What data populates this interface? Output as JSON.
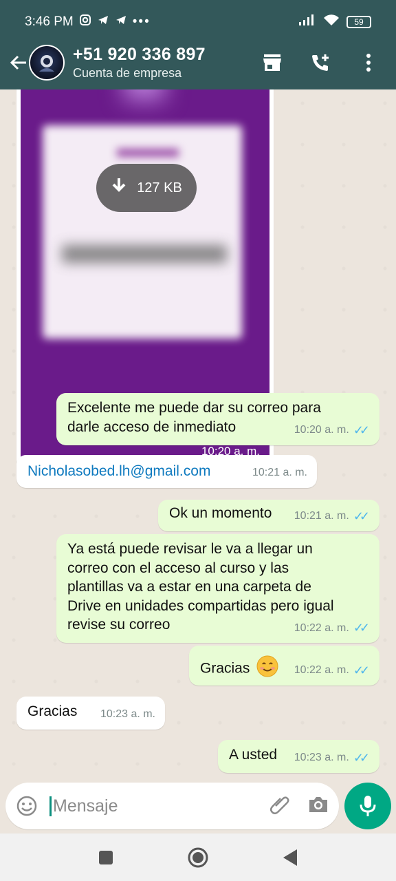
{
  "status_bar": {
    "time": "3:46 PM",
    "battery": "59"
  },
  "header": {
    "contact_name": "+51 920 336 897",
    "subtitle": "Cuenta de empresa"
  },
  "messages": [
    {
      "type": "image",
      "direction": "in",
      "size_label": "127 KB",
      "time": "10:20 a. m."
    },
    {
      "type": "text",
      "direction": "out",
      "text_line1": "Excelente me puede dar su correo para",
      "text_line2": "darle acceso de inmediato",
      "time": "10:20 a. m."
    },
    {
      "type": "text",
      "direction": "in",
      "text": "Nicholasobed.lh@gmail.com",
      "time": "10:21 a. m."
    },
    {
      "type": "text",
      "direction": "out",
      "text": "Ok un momento",
      "time": "10:21 a. m."
    },
    {
      "type": "text",
      "direction": "out",
      "lines": [
        "Ya está puede revisar le va a llegar un",
        "correo con el acceso al curso y las",
        "plantillas va a estar en una carpeta de",
        "Drive en unidades compartidas pero igual",
        "revise su correo"
      ],
      "time": "10:22 a. m."
    },
    {
      "type": "text",
      "direction": "out",
      "text": "Gracias",
      "time": "10:22 a. m."
    },
    {
      "type": "text",
      "direction": "in",
      "text": "Gracias",
      "time": "10:23 a. m."
    },
    {
      "type": "text",
      "direction": "out",
      "text": "A usted",
      "time": "10:23 a. m."
    }
  ],
  "input": {
    "placeholder": "Mensaje"
  },
  "colors": {
    "header": "#33585a",
    "outgoing_bubble": "#e8fcd5",
    "incoming_bubble": "#ffffff",
    "read_ticks": "#4fb6ec",
    "mic_button": "#00a884"
  }
}
